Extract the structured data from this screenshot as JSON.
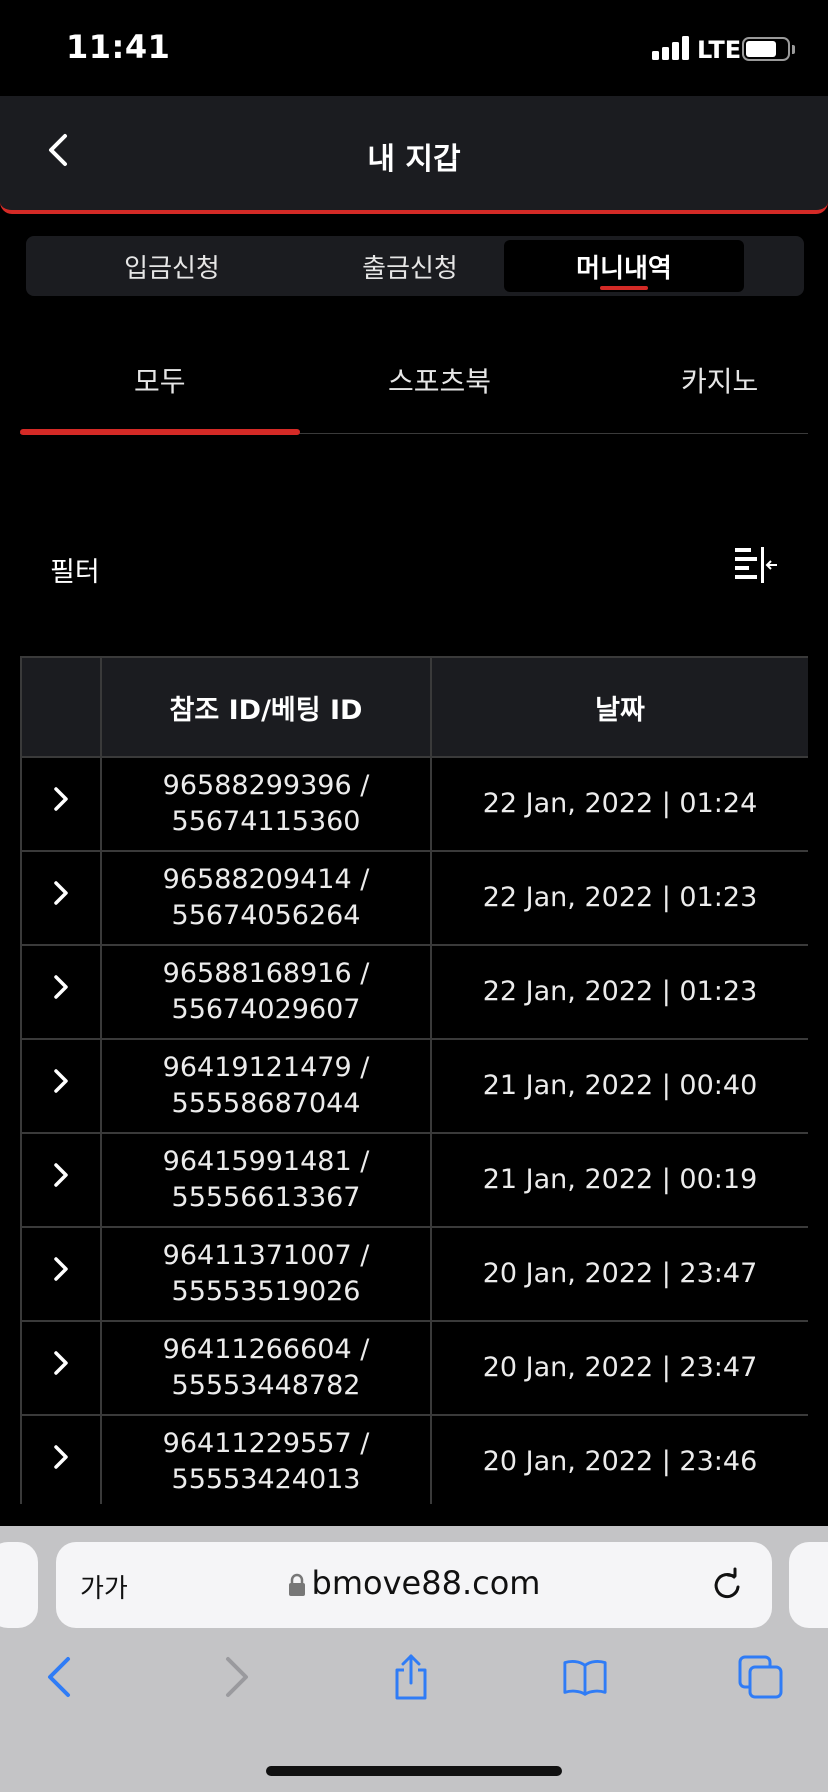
{
  "status_bar": {
    "time": "11:41",
    "network": "LTE"
  },
  "header": {
    "title": "내 지갑"
  },
  "main_tabs": [
    {
      "label": "입금신청"
    },
    {
      "label": "출금신청"
    },
    {
      "label": "머니내역"
    }
  ],
  "sub_tabs": [
    {
      "label": "모두"
    },
    {
      "label": "스포츠북"
    },
    {
      "label": "카지노"
    }
  ],
  "filter": {
    "label": "필터"
  },
  "table": {
    "headers": [
      "",
      "참조 ID/베팅 ID",
      "날짜"
    ],
    "rows": [
      {
        "ref": "96588299396 /",
        "bet": "55674115360",
        "date": "22 Jan, 2022 | 01:24"
      },
      {
        "ref": "96588209414 /",
        "bet": "55674056264",
        "date": "22 Jan, 2022 | 01:23"
      },
      {
        "ref": "96588168916 /",
        "bet": "55674029607",
        "date": "22 Jan, 2022 | 01:23"
      },
      {
        "ref": "96419121479 /",
        "bet": "55558687044",
        "date": "21 Jan, 2022 | 00:40"
      },
      {
        "ref": "96415991481 /",
        "bet": "55556613367",
        "date": "21 Jan, 2022 | 00:19"
      },
      {
        "ref": "96411371007 /",
        "bet": "55553519026",
        "date": "20 Jan, 2022 | 23:47"
      },
      {
        "ref": "96411266604 /",
        "bet": "55553448782",
        "date": "20 Jan, 2022 | 23:47"
      },
      {
        "ref": "96411229557 /",
        "bet": "55553424013",
        "date": "20 Jan, 2022 | 23:46"
      }
    ]
  },
  "browser": {
    "text_size": "가가",
    "url": "bmove88.com"
  },
  "colors": {
    "accent": "#d42a26",
    "header_bg": "#1b1c20",
    "ios_blue": "#2f7cf6"
  }
}
